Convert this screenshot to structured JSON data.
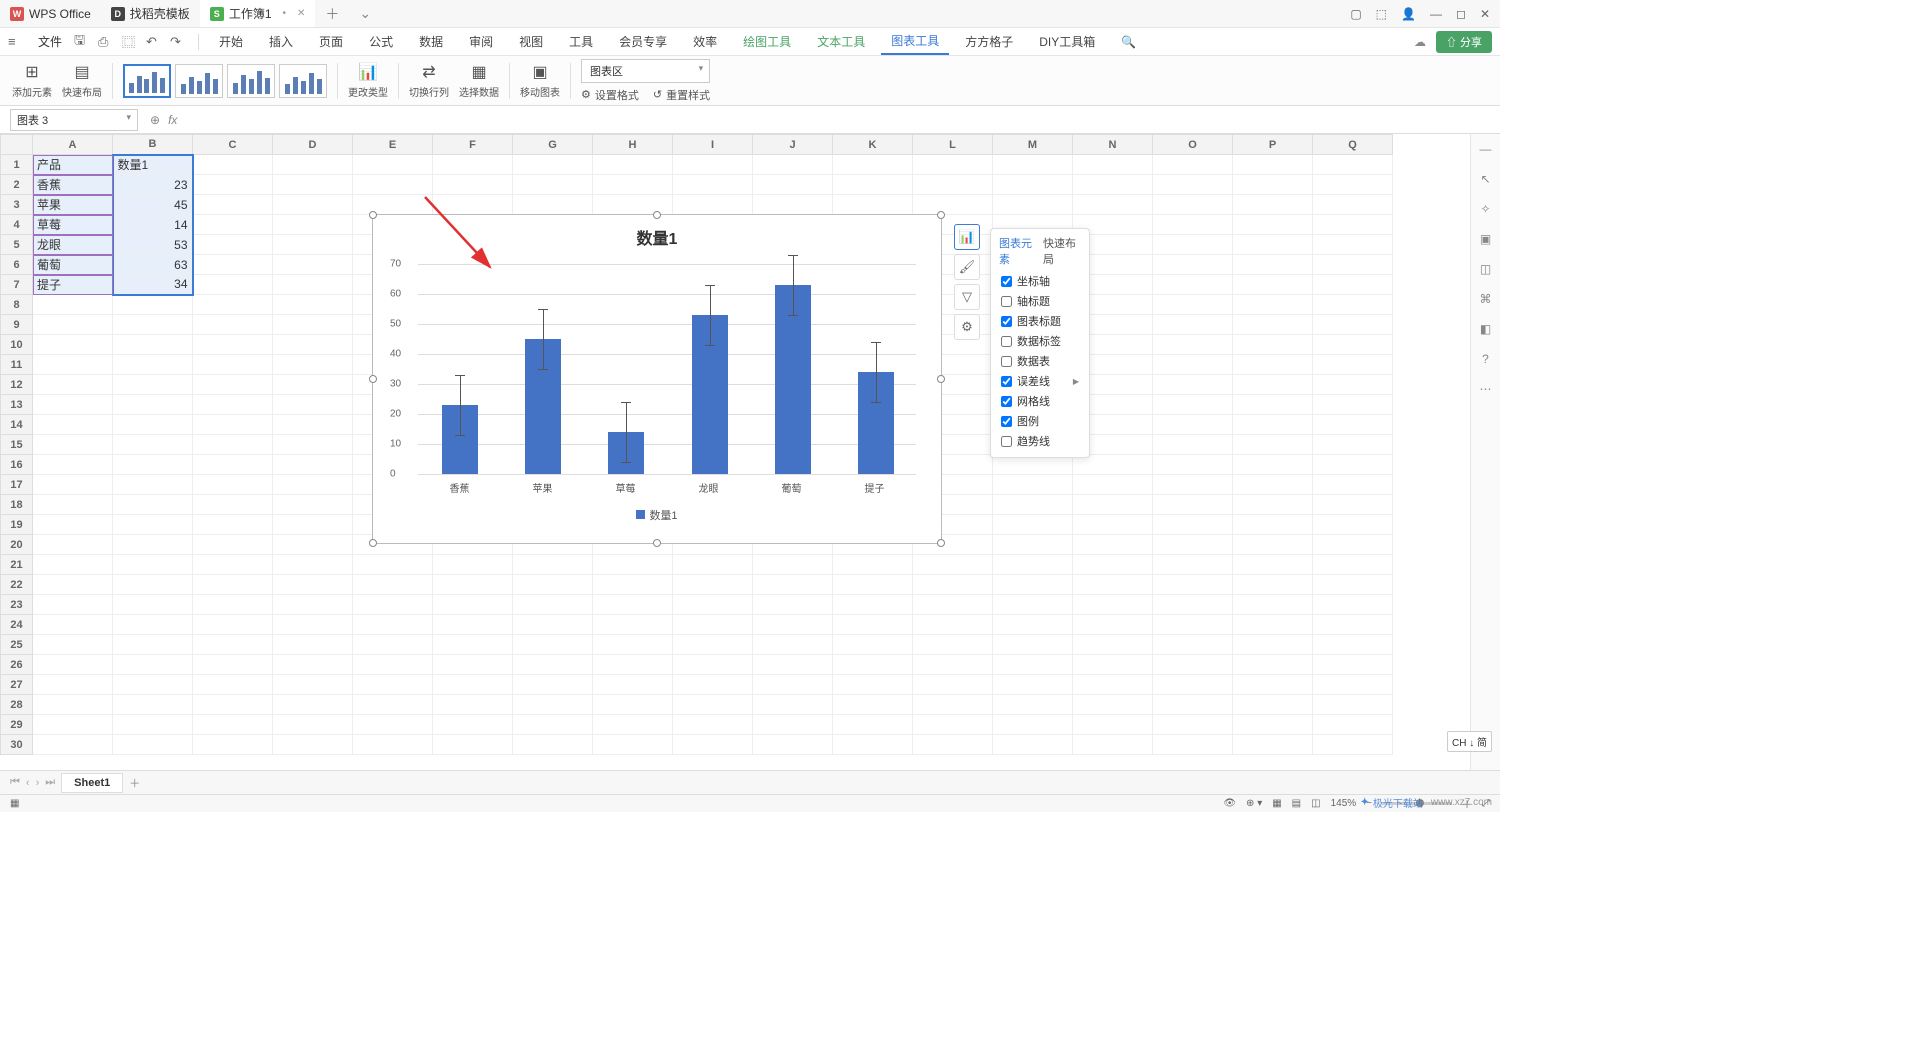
{
  "tabs": {
    "wps": "WPS Office",
    "template": "找稻壳模板",
    "workbook": "工作簿1"
  },
  "file_menu": "文件",
  "menus": [
    "开始",
    "插入",
    "页面",
    "公式",
    "数据",
    "审阅",
    "视图",
    "工具",
    "会员专享",
    "效率"
  ],
  "context_menus": [
    "绘图工具",
    "文本工具",
    "图表工具",
    "方方格子",
    "DIY工具箱"
  ],
  "active_menu": "图表工具",
  "share": "分享",
  "ribbon": {
    "add_element": "添加元素",
    "quick_layout": "快速布局",
    "change_type": "更改类型",
    "switch_rc": "切换行列",
    "select_data": "选择数据",
    "move_chart": "移动图表",
    "area_dropdown": "图表区",
    "set_format": "设置格式",
    "reset_style": "重置样式"
  },
  "namebox": "图表 3",
  "cols": [
    "A",
    "B",
    "C",
    "D",
    "E",
    "F",
    "G",
    "H",
    "I",
    "J",
    "K",
    "L",
    "M",
    "N",
    "O",
    "P",
    "Q"
  ],
  "rows": 30,
  "data_table": {
    "header": [
      "产品",
      "数量1"
    ],
    "rows": [
      [
        "香蕉",
        "23"
      ],
      [
        "苹果",
        "45"
      ],
      [
        "草莓",
        "14"
      ],
      [
        "龙眼",
        "53"
      ],
      [
        "葡萄",
        "63"
      ],
      [
        "提子",
        "34"
      ]
    ]
  },
  "chart_data": {
    "type": "bar",
    "title": "数量1",
    "categories": [
      "香蕉",
      "苹果",
      "草莓",
      "龙眼",
      "葡萄",
      "提子"
    ],
    "values": [
      23,
      45,
      14,
      53,
      63,
      34
    ],
    "error_bar": 10,
    "ylim": [
      0,
      70
    ],
    "ytick_step": 10,
    "legend": "数量1",
    "xlabel": "",
    "ylabel": ""
  },
  "popup": {
    "tab1": "图表元素",
    "tab2": "快速布局",
    "items": [
      {
        "label": "坐标轴",
        "checked": true
      },
      {
        "label": "轴标题",
        "checked": false
      },
      {
        "label": "图表标题",
        "checked": true
      },
      {
        "label": "数据标签",
        "checked": false
      },
      {
        "label": "数据表",
        "checked": false
      },
      {
        "label": "误差线",
        "checked": true,
        "arrow": true
      },
      {
        "label": "网格线",
        "checked": true
      },
      {
        "label": "图例",
        "checked": true
      },
      {
        "label": "趋势线",
        "checked": false
      }
    ]
  },
  "sheet": "Sheet1",
  "zoom": "145%",
  "ime": "CH ↓ 简",
  "watermark": {
    "site": "极光下载站",
    "url": "www.xz7.com"
  }
}
